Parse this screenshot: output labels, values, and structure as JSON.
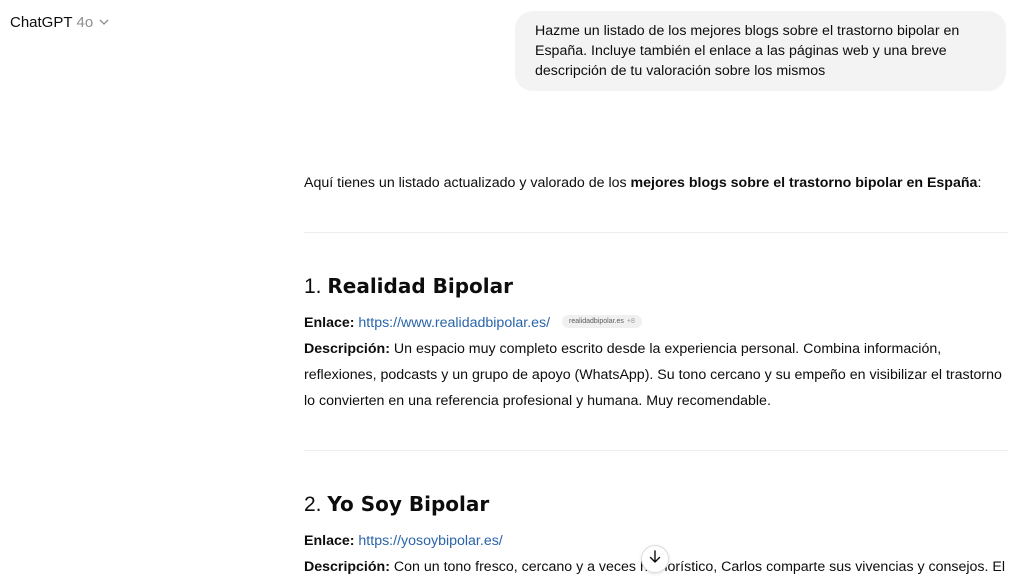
{
  "header": {
    "model_name": "ChatGPT",
    "model_version": "4o",
    "chevron": "chevron-down-icon"
  },
  "user_message": "Hazme un listado de los mejores blogs sobre el trastorno bipolar en España. Incluye también el enlace a las páginas web y una breve descripción de tu valoración sobre los mismos",
  "assistant": {
    "intro_prefix": "Aquí tienes un listado actualizado y valorado de los ",
    "intro_bold": "mejores blogs sobre el trastorno bipolar en España",
    "intro_suffix": ":",
    "link_label": "Enlace:",
    "desc_label": "Descripción:",
    "entries": [
      {
        "number": "1.",
        "name": "Realidad Bipolar",
        "url": "https://www.realidadbipolar.es/",
        "source_pill": "realidadbipolar.es",
        "source_more": "+8",
        "description": "Un espacio muy completo escrito desde la experiencia personal. Combina información, reflexiones, podcasts y un grupo de apoyo (WhatsApp). Su tono cercano y su empeño en visibilizar el trastorno lo convierten en una referencia profesional y humana. Muy recomendable."
      },
      {
        "number": "2.",
        "name": "Yo Soy Bipolar",
        "url": "https://yosoybipolar.es/",
        "description": "Con un tono fresco, cercano y a veces humorístico, Carlos comparte sus vivencias y consejos. El"
      }
    ]
  },
  "scroll_button_icon": "arrow-down-icon"
}
